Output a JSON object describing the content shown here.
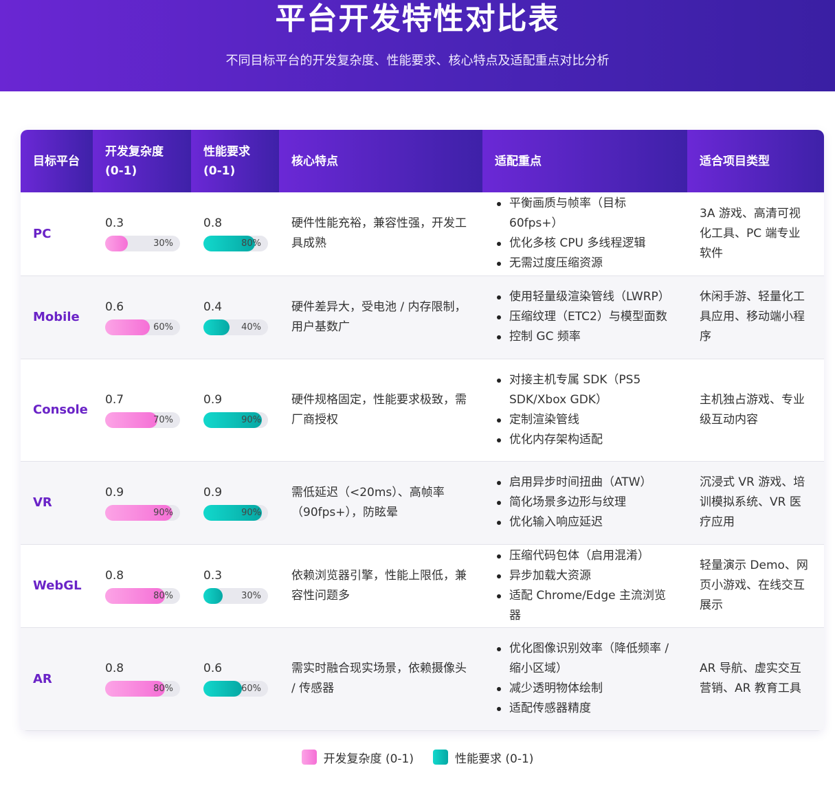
{
  "header": {
    "title": "平台开发特性对比表",
    "subtitle": "不同目标平台的开发复杂度、性能要求、核心特点及适配重点对比分析"
  },
  "colors": {
    "header_start": "#6a26d3",
    "header_end": "#3a1fa3",
    "platform_text": "#6a23c7",
    "complexity_bar": "#f56fd6",
    "performance_bar": "#06a8a4"
  },
  "table": {
    "columns": [
      "目标平台",
      "开发复杂度 (0-1)",
      "性能要求 (0-1)",
      "核心特点",
      "适配重点",
      "适合项目类型"
    ]
  },
  "chart_data": {
    "type": "table",
    "title": "平台开发特性对比表",
    "subtitle": "不同目标平台的开发复杂度、性能要求、核心特点及适配重点对比分析",
    "categories": [
      "PC",
      "Mobile",
      "Console",
      "VR",
      "WebGL",
      "AR"
    ],
    "series": [
      {
        "name": "开发复杂度 (0-1)",
        "values": [
          0.3,
          0.6,
          0.7,
          0.9,
          0.8,
          0.8
        ]
      },
      {
        "name": "性能要求 (0-1)",
        "values": [
          0.8,
          0.4,
          0.9,
          0.9,
          0.3,
          0.6
        ]
      }
    ],
    "ylim": [
      0,
      1
    ],
    "legend": [
      "开发复杂度 (0-1)",
      "性能要求 (0-1)"
    ],
    "legend_position": "bottom-center",
    "rows": [
      {
        "platform": "PC",
        "complexity": 0.3,
        "complexity_text": "0.3",
        "complexity_pct": "30%",
        "performance": 0.8,
        "performance_text": "0.8",
        "performance_pct": "80%",
        "features": "硬件性能充裕，兼容性强，开发工具成熟",
        "adaptation": [
          "平衡画质与帧率（目标 60fps+）",
          "优化多核 CPU 多线程逻辑",
          "无需过度压缩资源"
        ],
        "projects": "3A 游戏、高清可视化工具、PC 端专业软件"
      },
      {
        "platform": "Mobile",
        "complexity": 0.6,
        "complexity_text": "0.6",
        "complexity_pct": "60%",
        "performance": 0.4,
        "performance_text": "0.4",
        "performance_pct": "40%",
        "features": "硬件差异大，受电池 / 内存限制，用户基数广",
        "adaptation": [
          "使用轻量级渲染管线（LWRP）",
          "压缩纹理（ETC2）与模型面数",
          "控制 GC 频率"
        ],
        "projects": "休闲手游、轻量化工具应用、移动端小程序"
      },
      {
        "platform": "Console",
        "complexity": 0.7,
        "complexity_text": "0.7",
        "complexity_pct": "70%",
        "performance": 0.9,
        "performance_text": "0.9",
        "performance_pct": "90%",
        "features": "硬件规格固定，性能要求极致，需厂商授权",
        "adaptation": [
          "对接主机专属 SDK（PS5 SDK/Xbox GDK）",
          "定制渲染管线",
          "优化内存架构适配"
        ],
        "projects": "主机独占游戏、专业级互动内容"
      },
      {
        "platform": "VR",
        "complexity": 0.9,
        "complexity_text": "0.9",
        "complexity_pct": "90%",
        "performance": 0.9,
        "performance_text": "0.9",
        "performance_pct": "90%",
        "features": "需低延迟（<20ms）、高帧率（90fps+），防眩晕",
        "adaptation": [
          "启用异步时间扭曲（ATW）",
          "简化场景多边形与纹理",
          "优化输入响应延迟"
        ],
        "projects": "沉浸式 VR 游戏、培训模拟系统、VR 医疗应用"
      },
      {
        "platform": "WebGL",
        "complexity": 0.8,
        "complexity_text": "0.8",
        "complexity_pct": "80%",
        "performance": 0.3,
        "performance_text": "0.3",
        "performance_pct": "30%",
        "features": "依赖浏览器引擎，性能上限低，兼容性问题多",
        "adaptation": [
          "压缩代码包体（启用混淆）",
          "异步加载大资源",
          "适配 Chrome/Edge 主流浏览器"
        ],
        "projects": "轻量演示 Demo、网页小游戏、在线交互展示"
      },
      {
        "platform": "AR",
        "complexity": 0.8,
        "complexity_text": "0.8",
        "complexity_pct": "80%",
        "performance": 0.6,
        "performance_text": "0.6",
        "performance_pct": "60%",
        "features": "需实时融合现实场景，依赖摄像头 / 传感器",
        "adaptation": [
          "优化图像识别效率（降低频率 / 缩小区域）",
          "减少透明物体绘制",
          "适配传感器精度"
        ],
        "projects": "AR 导航、虚实交互营销、AR 教育工具"
      }
    ]
  }
}
